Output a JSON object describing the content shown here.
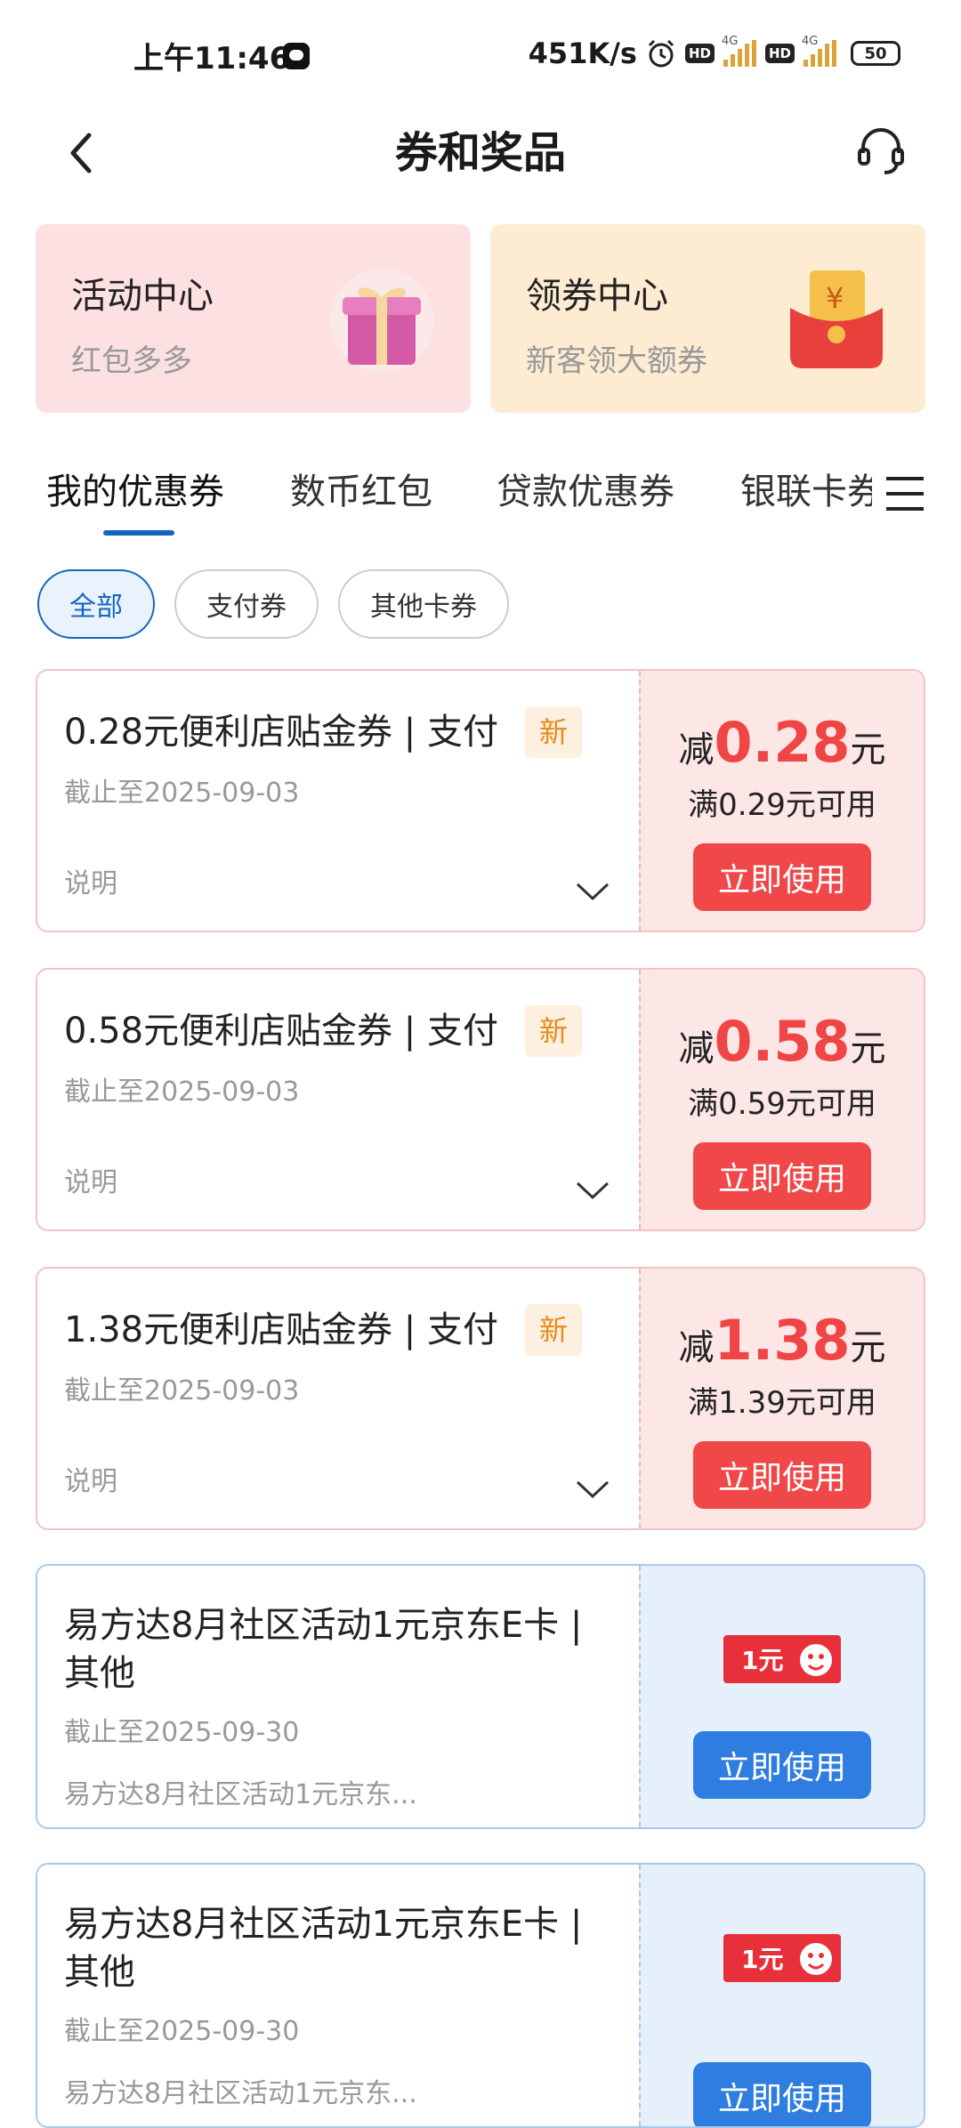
{
  "status_bar": {
    "time": "上午11:46",
    "speed": "451K/s",
    "hd1": "HD",
    "hd2": "HD",
    "net1": "4G",
    "net2": "4G",
    "battery": "50"
  },
  "header": {
    "title": "券和奖品"
  },
  "promo_cards": [
    {
      "title": "活动中心",
      "subtitle": "红包多多"
    },
    {
      "title": "领券中心",
      "subtitle": "新客领大额券"
    }
  ],
  "tabs": [
    {
      "label": "我的优惠券"
    },
    {
      "label": "数币红包"
    },
    {
      "label": "贷款优惠券"
    },
    {
      "label": "银联卡券"
    }
  ],
  "filters": [
    {
      "label": "全部"
    },
    {
      "label": "支付券"
    },
    {
      "label": "其他卡券"
    }
  ],
  "coupons": [
    {
      "title": "0.28元便利店贴金券 | 支付",
      "badge": "新",
      "expire": "截止至2025-09-03",
      "desc": "说明",
      "prefix": "减",
      "value": "0.28",
      "unit": "元",
      "condition": "满0.29元可用",
      "button": "立即使用"
    },
    {
      "title": "0.58元便利店贴金券 | 支付",
      "badge": "新",
      "expire": "截止至2025-09-03",
      "desc": "说明",
      "prefix": "减",
      "value": "0.58",
      "unit": "元",
      "condition": "满0.59元可用",
      "button": "立即使用"
    },
    {
      "title": "1.38元便利店贴金券 | 支付",
      "badge": "新",
      "expire": "截止至2025-09-03",
      "desc": "说明",
      "prefix": "减",
      "value": "1.38",
      "unit": "元",
      "condition": "满1.39元可用",
      "button": "立即使用"
    }
  ],
  "cards": [
    {
      "title": "易方达8月社区活动1元京东E卡 | 其他",
      "expire": "截止至2025-09-30",
      "desc": "易方达8月社区活动1元京东...",
      "art_label": "1元",
      "button": "立即使用"
    },
    {
      "title": "易方达8月社区活动1元京东E卡 | 其他",
      "expire": "截止至2025-09-30",
      "desc": "易方达8月社区活动1元京东...",
      "art_label": "1元",
      "button": "立即使用"
    }
  ]
}
